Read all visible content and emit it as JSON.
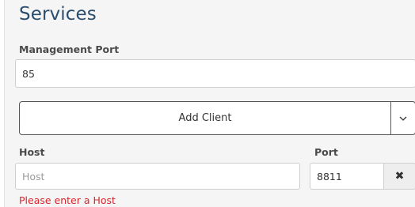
{
  "section": {
    "title": "Services"
  },
  "management_port": {
    "label": "Management Port",
    "value": "85"
  },
  "add_client": {
    "label": "Add Client",
    "caret_icon": "chevron-down-icon"
  },
  "client": {
    "host_label": "Host",
    "host_placeholder": "Host",
    "host_value": "",
    "port_label": "Port",
    "port_value": "8811",
    "remove_icon": "close-icon",
    "remove_glyph": "✖",
    "error": "Please enter a Host"
  },
  "colors": {
    "title": "#2b4d6e",
    "error": "#d9262c",
    "panel_bg": "#f5f5f5"
  }
}
